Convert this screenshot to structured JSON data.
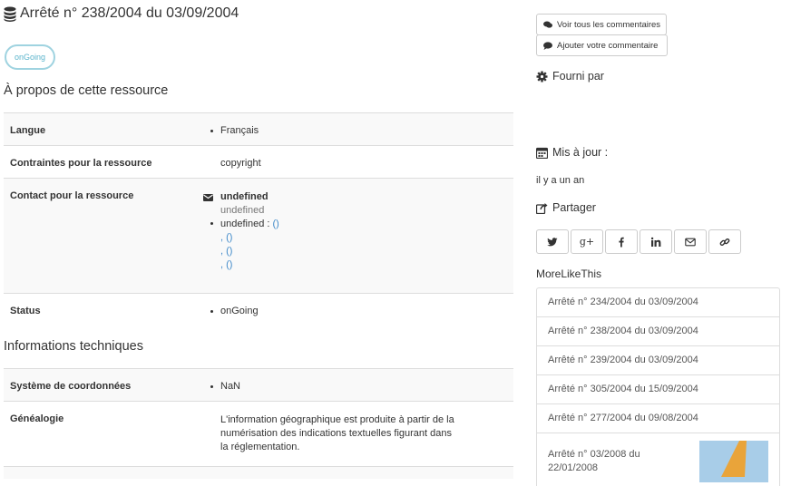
{
  "header": {
    "title": "Arrêté n° 238/2004 du 03/09/2004",
    "status_badge": "onGoing"
  },
  "about": {
    "section_title": "À propos de cette ressource",
    "rows": {
      "language": {
        "label": "Langue",
        "value": "Français"
      },
      "constraints": {
        "label": "Contraintes pour la ressource",
        "value": "copyright"
      },
      "contact": {
        "label": "Contact pour la ressource",
        "name": "undefined",
        "org": "undefined",
        "role_prefix": "undefined : ",
        "role_link": "()",
        "extra_links": [
          ", ()",
          ", ()",
          ", ()"
        ]
      },
      "status": {
        "label": "Status",
        "value": "onGoing"
      }
    }
  },
  "technical": {
    "section_title": "Informations techniques",
    "rows": {
      "crs": {
        "label": "Système de coordonnées",
        "value": "NaN"
      },
      "lineage": {
        "label": "Généalogie",
        "value": "L'information géographique est produite à partir de la numérisation des indications textuelles figurant dans la réglementation."
      }
    }
  },
  "sidebar": {
    "view_comments": "Voir tous les commentaires",
    "add_comment": "Ajouter votre commentaire",
    "provided_by": "Fourni par",
    "updated_label": "Mis à jour :",
    "updated_value": "il y a un an",
    "share_label": "Partager",
    "share_icons": [
      "twitter-icon",
      "google-plus-icon",
      "facebook-icon",
      "linkedin-icon",
      "email-icon",
      "link-icon"
    ],
    "more_like_this": "MoreLikeThis",
    "related": [
      "Arrêté n° 234/2004 du 03/09/2004",
      "Arrêté n° 238/2004 du 03/09/2004",
      "Arrêté n° 239/2004 du 03/09/2004",
      "Arrêté n° 305/2004 du 15/09/2004",
      "Arrêté n° 277/2004 du 09/08/2004",
      "Arrêté n° 03/2008 du 22/01/2008"
    ]
  },
  "colors": {
    "accent_link": "#428bca",
    "badge_border": "#9fd3e0",
    "thumb_fill": "#e9a43a",
    "thumb_bg": "#a8cde8"
  }
}
